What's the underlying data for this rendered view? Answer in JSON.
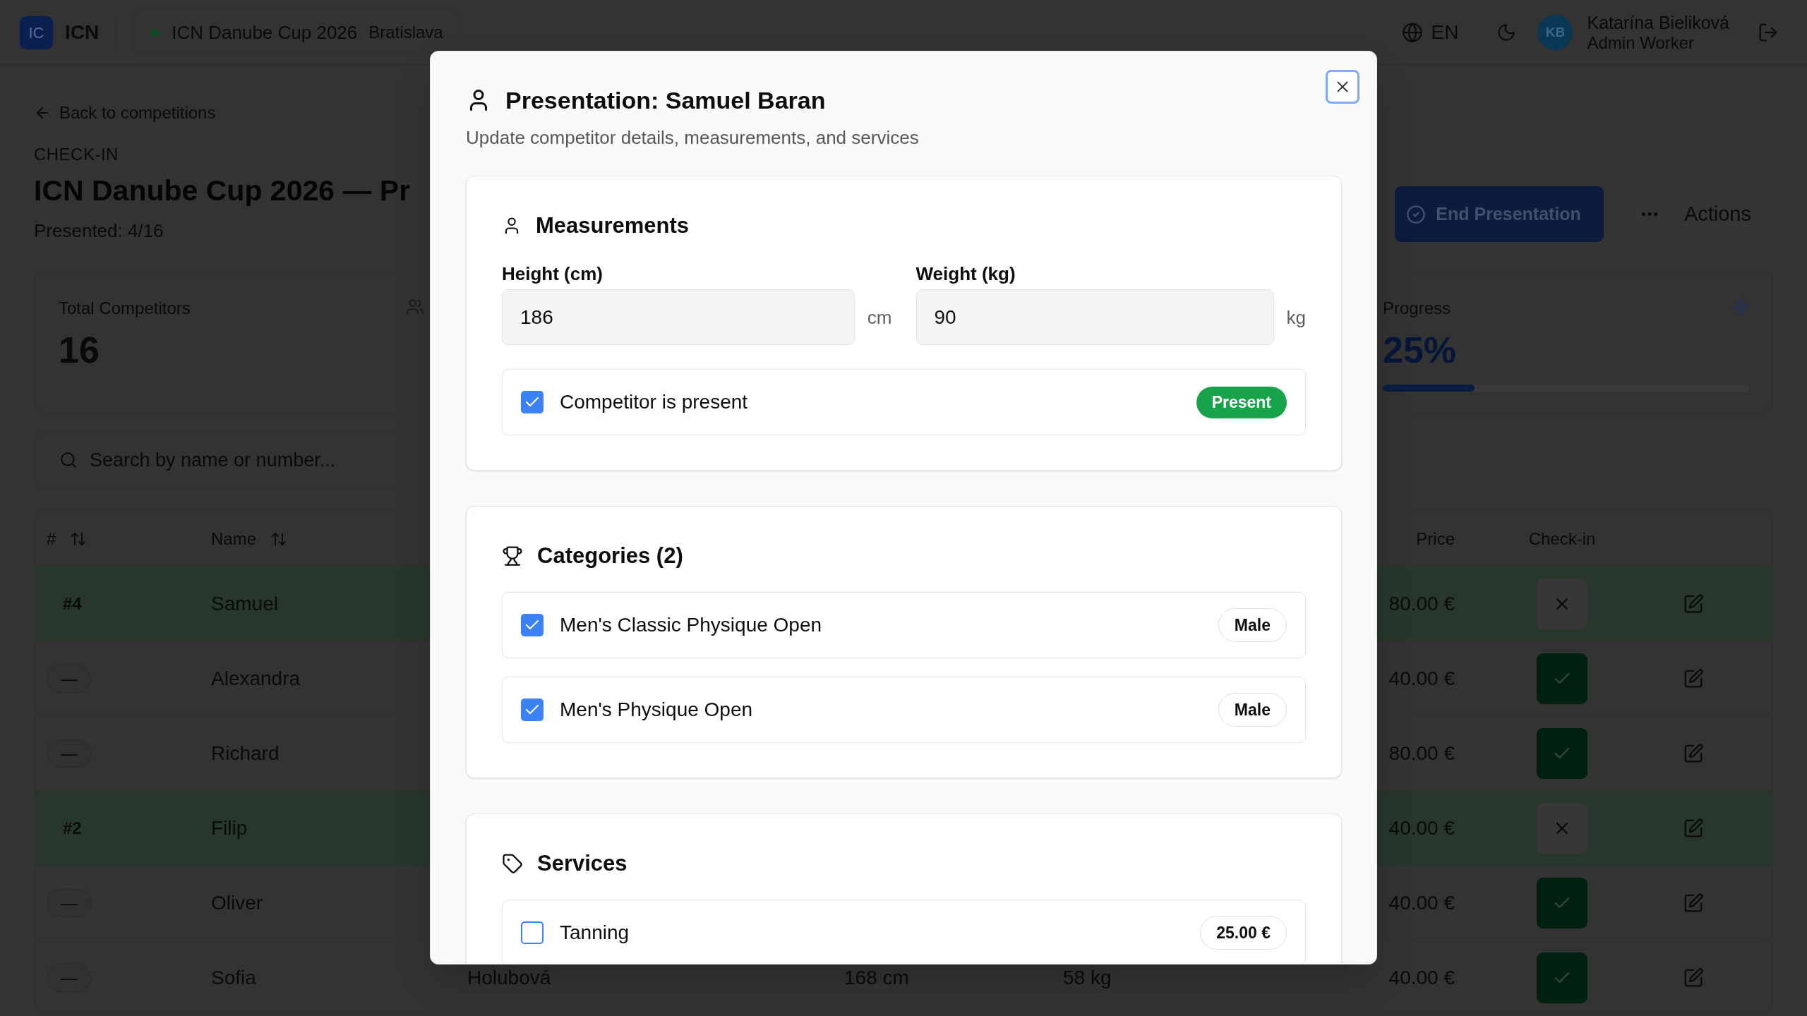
{
  "topbar": {
    "logo": "IC",
    "brand": "ICN",
    "competition": {
      "name": "ICN Danube Cup 2026",
      "city": "Bratislava"
    },
    "language": "EN",
    "user": {
      "initials": "KB",
      "name": "Katarína Bieliková",
      "role": "Admin Worker"
    }
  },
  "page": {
    "back_link": "Back to competitions",
    "eyebrow": "CHECK-IN",
    "title": "ICN Danube Cup 2026 — Pr",
    "subtitle": "Presented: 4/16",
    "actions": [
      {
        "label": "End Presentation",
        "kind": "primary"
      },
      {
        "label": "Actions",
        "kind": "menu"
      }
    ]
  },
  "stats": [
    {
      "label": "Total Competitors",
      "value": "16",
      "kind": "count"
    },
    {
      "label": "Progress",
      "value": "25%",
      "kind": "progress",
      "level": 0.25
    }
  ],
  "search": {
    "placeholder": "Search by name or number..."
  },
  "table": {
    "columns": [
      {
        "label": "#",
        "sortable": true
      },
      {
        "label": "Name",
        "sortable": true
      },
      {
        "label": "Price",
        "sortable": false
      },
      {
        "label": "Check-in",
        "sortable": false
      }
    ],
    "rows": [
      {
        "number": "#4",
        "number_badge": false,
        "first_name": "Samuel",
        "price": "80.00 €",
        "checked_in": false,
        "highlighted": true
      },
      {
        "number": "—",
        "number_badge": true,
        "first_name": "Alexandra",
        "price": "40.00 €",
        "checked_in": true,
        "highlighted": false
      },
      {
        "number": "—",
        "number_badge": true,
        "first_name": "Richard",
        "price": "80.00 €",
        "checked_in": true,
        "highlighted": false
      },
      {
        "number": "#2",
        "number_badge": false,
        "first_name": "Filip",
        "price": "40.00 €",
        "checked_in": false,
        "highlighted": true
      },
      {
        "number": "—",
        "number_badge": true,
        "first_name": "Oliver",
        "price": "40.00 €",
        "checked_in": true,
        "highlighted": false
      },
      {
        "number": "—",
        "number_badge": true,
        "first_name": "Sofia",
        "last_name": "Holubová",
        "height": "168 cm",
        "weight": "58 kg",
        "price": "40.00 €",
        "checked_in": true,
        "highlighted": false
      }
    ]
  },
  "dialog": {
    "title": "Presentation: Samuel Baran",
    "subtitle": "Update competitor details, measurements, and services",
    "sections": [
      {
        "kind": "measurements",
        "title": "Measurements",
        "fields": [
          {
            "label": "Height (cm)",
            "value": "186",
            "unit": "cm"
          },
          {
            "label": "Weight (kg)",
            "value": "90",
            "unit": "kg"
          }
        ],
        "options": [
          {
            "label": "Competitor is present",
            "checked": true,
            "badge": "Present"
          }
        ]
      },
      {
        "kind": "categories",
        "title": "Categories (2)",
        "options": [
          {
            "label": "Men's Classic Physique Open",
            "checked": true,
            "badge": "Male"
          },
          {
            "label": "Men's Physique Open",
            "checked": true,
            "badge": "Male"
          }
        ]
      },
      {
        "kind": "services",
        "title": "Services",
        "options": [
          {
            "label": "Tanning",
            "checked": false,
            "badge": "25.00 €"
          }
        ]
      }
    ]
  }
}
